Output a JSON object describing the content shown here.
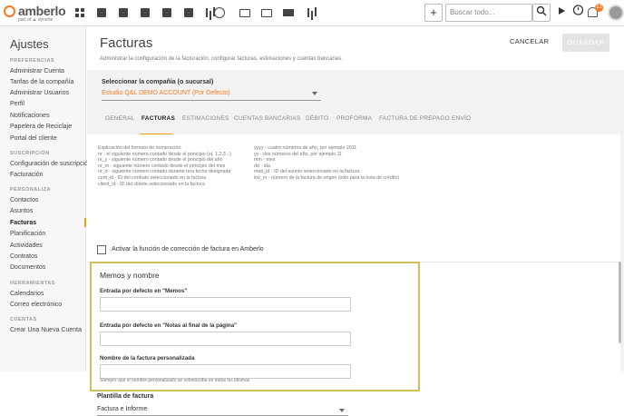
{
  "app": {
    "logo_text": "amberlo",
    "logo_sub": "part of ▲ dyrsme"
  },
  "header": {
    "search_placeholder": "Buscar todo...",
    "add_label": "+",
    "notification_count": "12",
    "nav_icons": [
      "dashboard-icon",
      "contacts-icon",
      "briefcase-icon",
      "invoice-icon",
      "document-icon",
      "calendar-icon",
      "checklist-icon",
      "history-icon",
      "folder-icon",
      "page-icon",
      "mail-icon",
      "reports-icon"
    ]
  },
  "sidebar": {
    "title": "Ajustes",
    "groups": [
      {
        "head": "PREFERENCIAS",
        "items": [
          "Administrar Cuenta",
          "Tarifas de la compañía",
          "Administrar Usuarios",
          "Perfil",
          "Notificaciones",
          "Papelera de Reciclaje",
          "Portal del cliente"
        ]
      },
      {
        "head": "SUSCRIPCIÓN",
        "items": [
          "Configuración de suscripción",
          "Facturación"
        ]
      },
      {
        "head": "PERSONALIZA",
        "items": [
          "Contactos",
          "Asuntos",
          "Facturas",
          "Planificación",
          "Actividades",
          "Contratos",
          "Documentos"
        ]
      },
      {
        "head": "HERRAMIENTAS",
        "items": [
          "Calendarios",
          "Correo electrónico"
        ]
      },
      {
        "head": "CUENTAS",
        "items": [
          "Crear Una Nueva Cuenta"
        ]
      }
    ],
    "active_item": "Facturas"
  },
  "page": {
    "title": "Facturas",
    "subtitle": "Administrar la configuración de la facturación, configurar facturas, estimaciones y cuentas bancarias.",
    "cancel_label": "CANCELAR",
    "save_label": "GUARDAR"
  },
  "company": {
    "label": "Seleccionar la compañía (o sucursal)",
    "value": "Estudio Q&L DEMO ACCOUNT (Por Defecto)"
  },
  "tabs": [
    "GENERAL",
    "FACTURAS",
    "ESTIMACIONES",
    "CUENTAS BANCARIAS",
    "DÉBITO",
    "PROFORMA",
    "FACTURA DE PREPAGO",
    "ENVÍO"
  ],
  "active_tab": "FACTURAS",
  "explanation": {
    "left": [
      "Explicación del formato de numeración:",
      "nr - el siguiente número contado desde el principio (ej. 1,2,3...)",
      "nr_y - siguiente número contado desde el principio del año",
      "nr_m - siguiente número contado desde el principio del mes",
      "nr_d - siguiente número contado durante una fecha designada",
      "cont_id - ID del contrato seleccionado en la factura",
      "client_id - ID del cliente seleccionado en la factura"
    ],
    "right": [
      "yyyy - cuatro números de año, por ejemplo 2011",
      "yy - dos números del año, por ejemplo 11",
      "mm - mes",
      "dd - día",
      "matt_id - ID del asunto seleccionado en la factura",
      "inv_nr - número de la factura de origen (sólo para la nota de crédito)"
    ]
  },
  "checkbox": {
    "label": "Activar la función de corrección de factura en Amberlo",
    "checked": false
  },
  "memos": {
    "title": "Memos y nombre",
    "memos_label": "Entrada por defecto en \"Memos\"",
    "memos_value": "",
    "notes_label": "Entrada por defecto en \"Notas al final de la página\"",
    "notes_value": "",
    "name_label": "Nombre de la factura personalizada",
    "name_value": "",
    "name_help": "Siempre que el nombre personalizado se sobrescriba en todos los idiomas"
  },
  "template": {
    "label": "Plantilla de factura",
    "value": "Factura e Informe"
  },
  "colors": {
    "accent": "#f47c20",
    "highlight_border": "#cfc05a",
    "tab_underline": "#f4a000"
  }
}
